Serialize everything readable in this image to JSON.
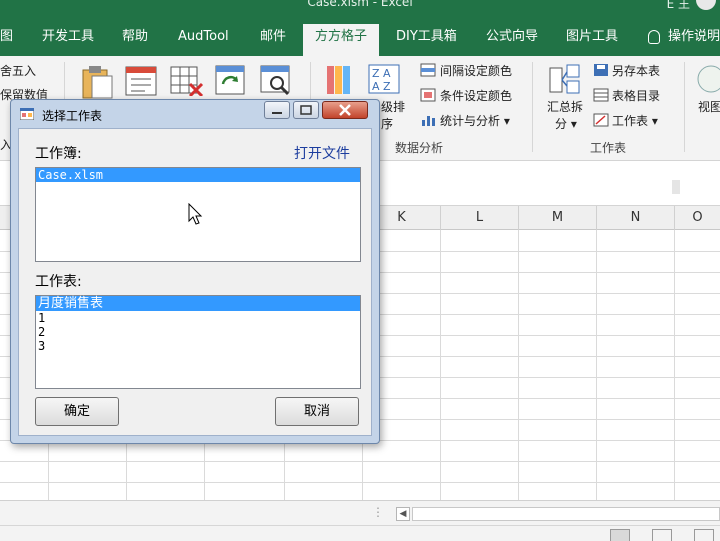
{
  "window": {
    "title": "Case.xlsm  -  Excel",
    "user_label": "E 王"
  },
  "menu": {
    "tabs": [
      {
        "label": "图",
        "active": false
      },
      {
        "label": "开发工具",
        "active": false
      },
      {
        "label": "帮助",
        "active": false
      },
      {
        "label": "AudTool",
        "active": false
      },
      {
        "label": "邮件",
        "active": false
      },
      {
        "label": "方方格子",
        "active": true
      },
      {
        "label": "DIY工具箱",
        "active": false
      },
      {
        "label": "公式向导",
        "active": false
      },
      {
        "label": "图片工具",
        "active": false
      }
    ],
    "tell_me": "操作说明"
  },
  "ribbon": {
    "left_items": [
      "舍五入",
      "保留数值",
      "入"
    ],
    "partial_labels": [
      "级排",
      "序"
    ],
    "color_buttons": [
      "间隔设定颜色",
      "条件设定颜色",
      "统计与分析"
    ],
    "data_analysis_label": "数据分析",
    "summary_split": [
      "汇总拆",
      "分"
    ],
    "sheet_buttons": [
      "另存本表",
      "表格目录",
      "工作表"
    ],
    "sheet_group_label": "工作表",
    "view_label": "视图"
  },
  "grid": {
    "columns": [
      "K",
      "L",
      "M",
      "N",
      "O"
    ]
  },
  "dialog": {
    "title": "选择工作表",
    "workbook_label": "工作簿:",
    "open_file_link": "打开文件",
    "workbooks": [
      "Case.xlsm"
    ],
    "worksheet_label": "工作表:",
    "worksheets": [
      "月度销售表",
      "1",
      "2",
      "3"
    ],
    "ok_button": "确定",
    "cancel_button": "取消"
  },
  "statusbar": {
    "scroll_dots": "⋮"
  },
  "colors": {
    "excel_green": "#217346",
    "selection_blue": "#3399ff",
    "link_blue": "#1c3d9e"
  },
  "icons": [
    "lightbulb-icon",
    "minimize-icon",
    "maximize-icon",
    "close-icon",
    "mouse-cursor-icon"
  ]
}
